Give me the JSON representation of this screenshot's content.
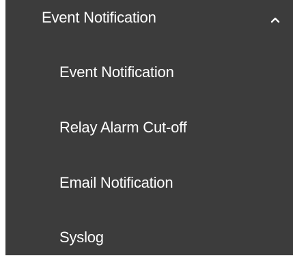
{
  "menu": {
    "section": {
      "label": "Event Notification",
      "expanded": true,
      "icon": "chevron-up-icon"
    },
    "items": [
      {
        "label": "Event Notification"
      },
      {
        "label": "Relay Alarm Cut-off"
      },
      {
        "label": "Email Notification"
      },
      {
        "label": "Syslog"
      }
    ]
  },
  "colors": {
    "background": "#3c3c3c",
    "text": "#ffffff"
  }
}
